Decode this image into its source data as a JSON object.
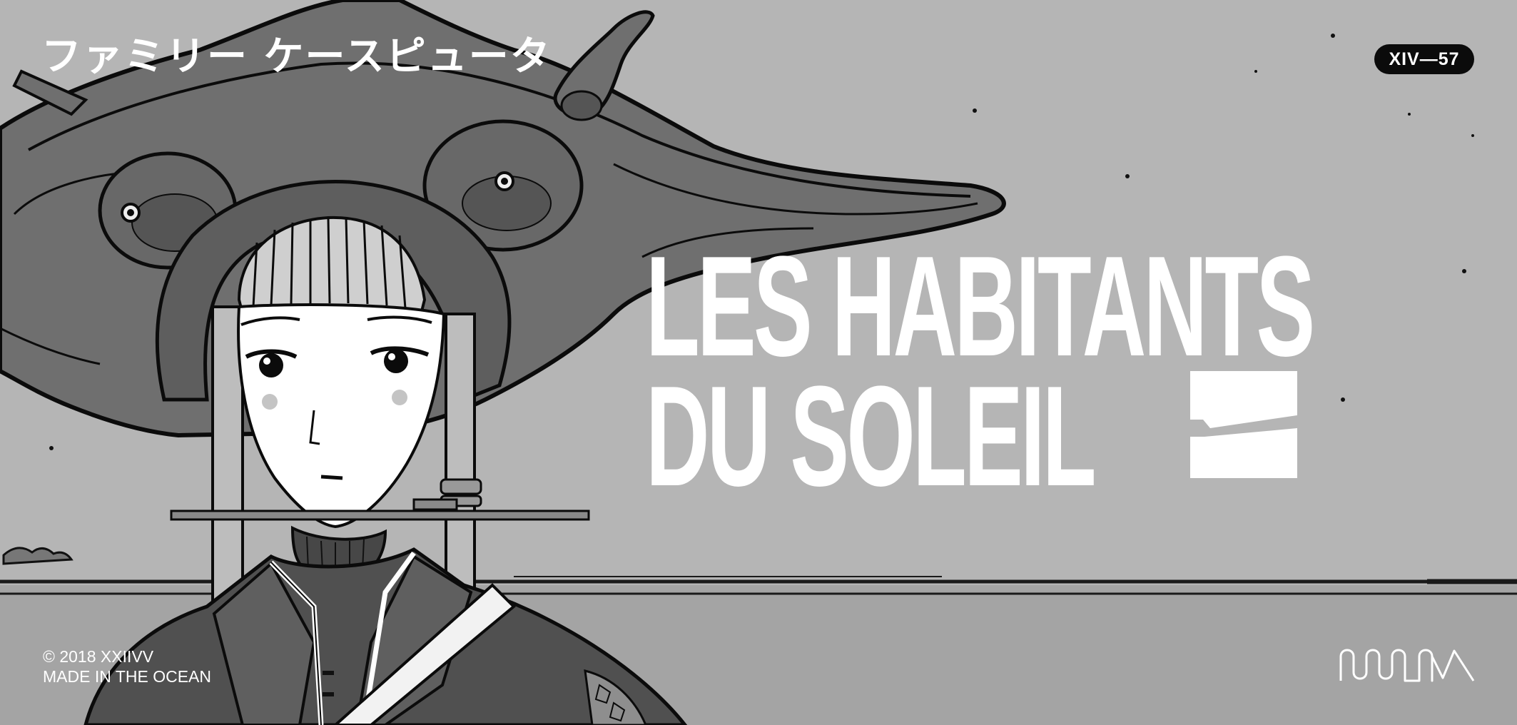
{
  "header": {
    "katakana_title": "ファミリー ケースピュータ",
    "badge": "XIV—57"
  },
  "headline": {
    "line1": "LES HABITANTS",
    "line2": "DU SOLEIL"
  },
  "footer": {
    "copyright": "© 2018 XXIIVV",
    "tagline": "MADE IN THE OCEAN"
  },
  "icons": {
    "emblem": "slash-square-emblem-icon",
    "maker_logo": "wave-logo-icon"
  },
  "colors": {
    "sky": "#b5b5b5",
    "ground": "#a4a4a4",
    "ink": "#0b0b0b",
    "text": "#ffffff"
  }
}
